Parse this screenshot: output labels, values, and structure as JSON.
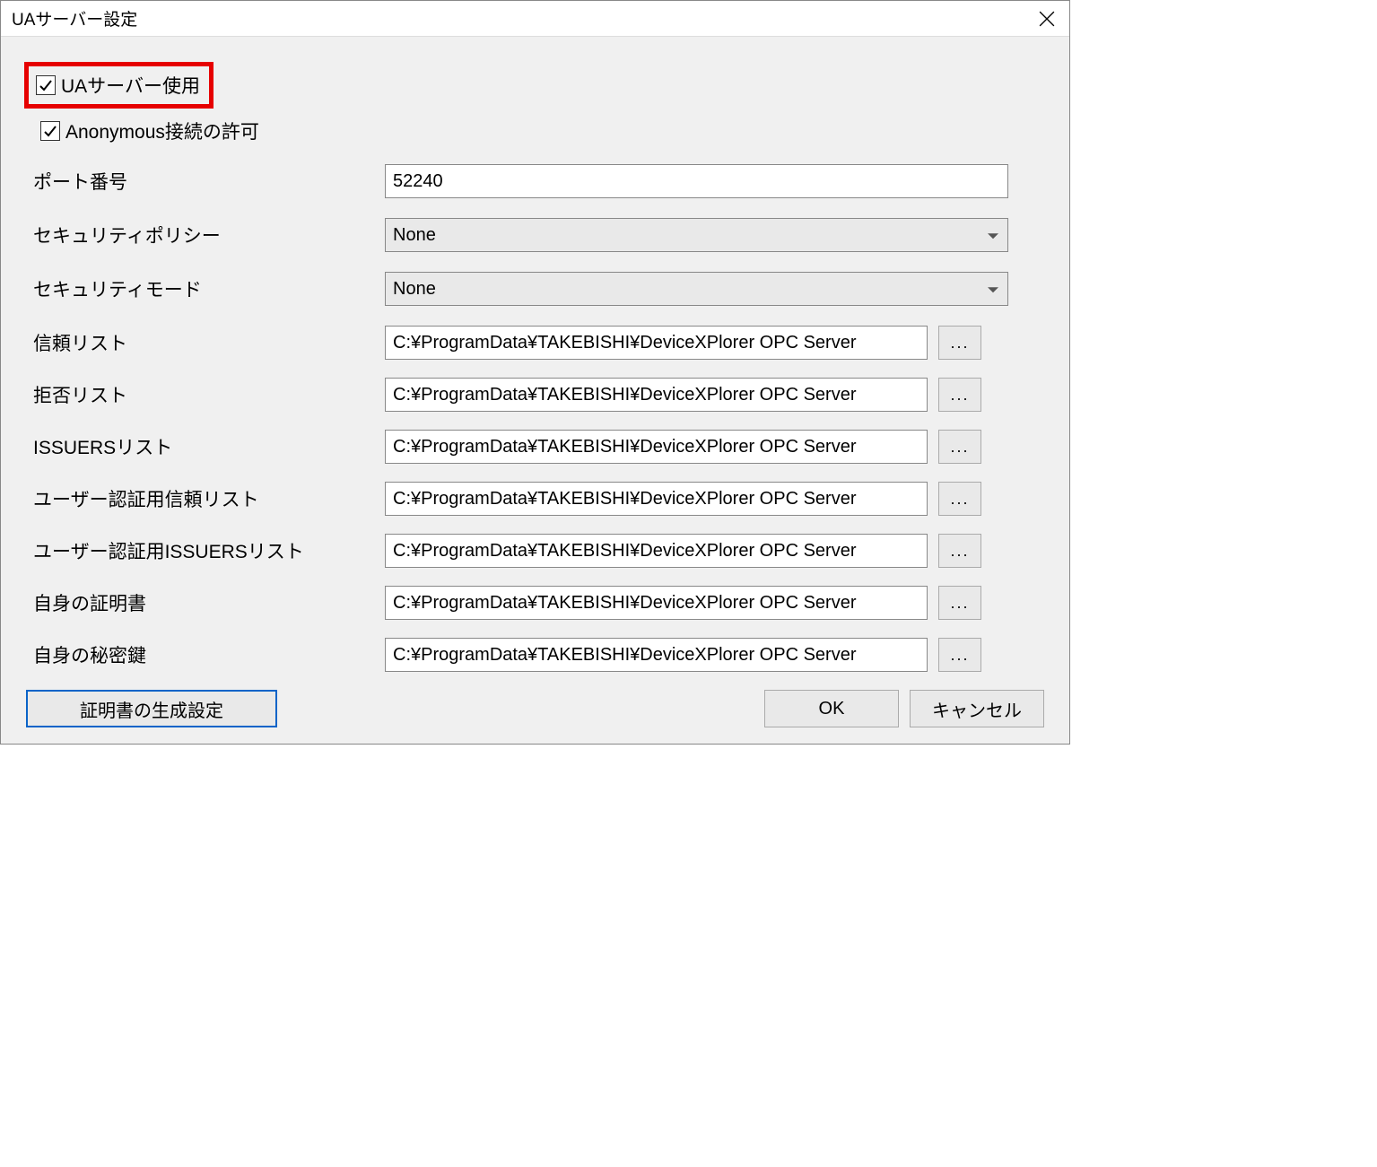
{
  "title": "UAサーバー設定",
  "checkboxes": {
    "use_ua_server": {
      "label": "UAサーバー使用",
      "checked": true
    },
    "allow_anonymous": {
      "label": "Anonymous接続の許可",
      "checked": true
    }
  },
  "fields": {
    "port": {
      "label": "ポート番号",
      "value": "52240"
    },
    "security_policy": {
      "label": "セキュリティポリシー",
      "value": "None"
    },
    "security_mode": {
      "label": "セキュリティモード",
      "value": "None"
    },
    "trust_list": {
      "label": "信頼リスト",
      "value": "C:¥ProgramData¥TAKEBISHI¥DeviceXPlorer OPC Server"
    },
    "reject_list": {
      "label": "拒否リスト",
      "value": "C:¥ProgramData¥TAKEBISHI¥DeviceXPlorer OPC Server"
    },
    "issuers_list": {
      "label": "ISSUERSリスト",
      "value": "C:¥ProgramData¥TAKEBISHI¥DeviceXPlorer OPC Server"
    },
    "user_trust_list": {
      "label": "ユーザー認証用信頼リスト",
      "value": "C:¥ProgramData¥TAKEBISHI¥DeviceXPlorer OPC Server"
    },
    "user_issuers_list": {
      "label": "ユーザー認証用ISSUERSリスト",
      "value": "C:¥ProgramData¥TAKEBISHI¥DeviceXPlorer OPC Server"
    },
    "own_cert": {
      "label": "自身の証明書",
      "value": "C:¥ProgramData¥TAKEBISHI¥DeviceXPlorer OPC Server"
    },
    "own_private_key": {
      "label": "自身の秘密鍵",
      "value": "C:¥ProgramData¥TAKEBISHI¥DeviceXPlorer OPC Server"
    }
  },
  "buttons": {
    "browse": "...",
    "cert_gen": "証明書の生成設定",
    "ok": "OK",
    "cancel": "キャンセル"
  }
}
